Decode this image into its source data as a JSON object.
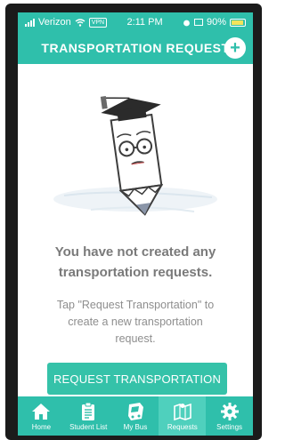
{
  "status_bar": {
    "carrier": "Verizon",
    "vpn": "VPN",
    "time": "2:11 PM",
    "battery": "90%"
  },
  "header": {
    "title": "TRANSPORTATION REQUEST",
    "add_symbol": "+"
  },
  "empty_state": {
    "title_line1": "You have not created any",
    "title_line2": "transportation requests.",
    "hint_line1": "Tap \"Request Transportation\" to",
    "hint_line2": "create a new transportation",
    "hint_line3": "request."
  },
  "primary_button": {
    "label": "REQUEST TRANSPORTATION"
  },
  "tabs": [
    {
      "label": "Home",
      "icon": "home-icon"
    },
    {
      "label": "Student List",
      "icon": "clipboard-icon"
    },
    {
      "label": "My Bus",
      "icon": "bus-icon"
    },
    {
      "label": "Requests",
      "icon": "map-icon",
      "active": true
    },
    {
      "label": "Settings",
      "icon": "gear-icon"
    }
  ],
  "colors": {
    "accent": "#2fbfab",
    "active_tab": "#4fd0bd",
    "button": "#35c2a9",
    "text_muted": "#7a7a7a"
  }
}
